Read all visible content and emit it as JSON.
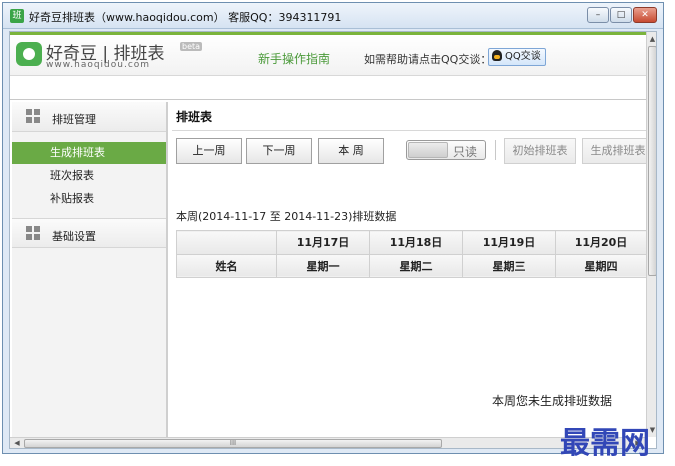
{
  "window": {
    "title": "好奇豆排班表（www.haoqidou.com）   客服QQ：394311791",
    "minimize": "–",
    "maximize": "□",
    "close": "✕"
  },
  "header": {
    "logo_name": "好奇豆 | 排班表",
    "logo_url": "www.haoqidou.com",
    "beta": "beta",
    "guide_link": "新手操作指南",
    "help_text": "如需帮助请点击QQ交谈：",
    "qq_button": "QQ交谈"
  },
  "sidebar": {
    "groups": [
      {
        "label": "排班管理"
      },
      {
        "label": "基础设置"
      }
    ],
    "items": [
      {
        "label": "生成排班表",
        "active": true
      },
      {
        "label": "班次报表",
        "active": false
      },
      {
        "label": "补贴报表",
        "active": false
      }
    ]
  },
  "main": {
    "title": "排班表",
    "toolbar": {
      "prev_week": "上一周",
      "next_week": "下一周",
      "this_week": "本 周",
      "readonly_toggle": "只读",
      "init_schedule": "初始排班表",
      "generate_schedule": "生成排班表"
    },
    "range_text": "本周(2014-11-17 至 2014-11-23)排班数据",
    "table": {
      "dates": [
        "",
        "11月17日",
        "11月18日",
        "11月19日",
        "11月20日"
      ],
      "weekdays": [
        "姓名",
        "星期一",
        "星期二",
        "星期三",
        "星期四"
      ]
    },
    "empty_message": "本周您未生成排班数据"
  },
  "scrollbar": {
    "h_grip": "III"
  },
  "watermark": "最需网",
  "colors": {
    "accent_green": "#6aaa45",
    "header_green_line": "#7bb43c",
    "watermark_blue": "#3247b7"
  }
}
